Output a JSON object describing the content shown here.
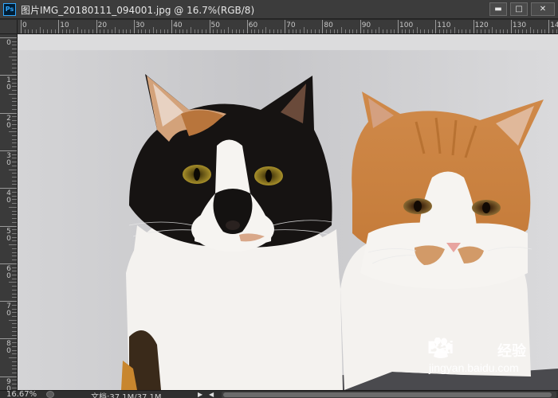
{
  "window": {
    "app_icon": "photoshop-icon",
    "app_icon_text": "Ps",
    "title": "图片IMG_20180111_094001.jpg @ 16.7%(RGB/8)",
    "minimize_label": "▬",
    "maximize_label": "□",
    "close_label": "✕"
  },
  "rulers": {
    "horizontal_labels": [
      "0",
      "10",
      "20",
      "30",
      "40",
      "50",
      "60",
      "70",
      "80",
      "90",
      "100",
      "110",
      "120",
      "130",
      "140"
    ],
    "vertical_labels": [
      "0",
      "10",
      "20",
      "30",
      "40",
      "50",
      "60",
      "70",
      "80",
      "90"
    ]
  },
  "canvas": {
    "image": "photo-two-cats",
    "background_color": "#cfcfd0"
  },
  "watermark": {
    "logo_text": "Bai",
    "logo_suffix": "经验",
    "url": "jingyan.baidu.com"
  },
  "statusbar": {
    "zoom": "16.67%",
    "doc_info": "文档:37.1M/37.1M",
    "prev_label": "▶",
    "next_label": "◀"
  }
}
